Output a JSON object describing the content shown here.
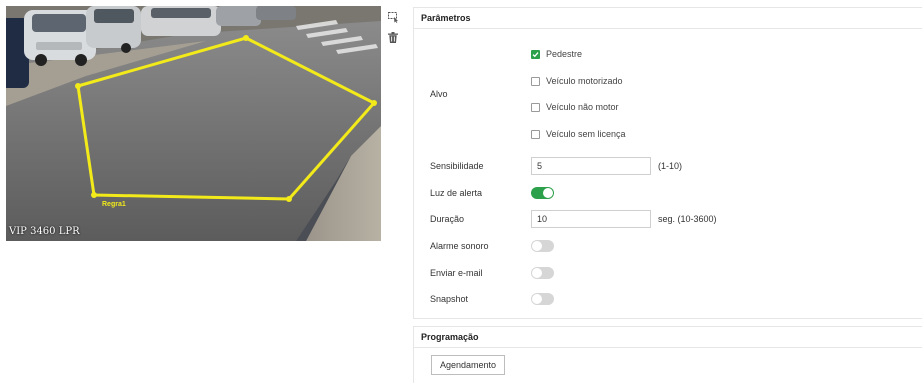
{
  "preview": {
    "osd_text": "VIP 3460 LPR",
    "rule_label": "Regra1",
    "rule_color": "#f3ea1a",
    "tools": [
      {
        "name": "draw-region-icon",
        "tooltip": ""
      },
      {
        "name": "trash-icon",
        "tooltip": ""
      }
    ]
  },
  "parameters": {
    "title": "Parâmetros",
    "alvo_label": "Alvo",
    "targets": [
      {
        "label": "Pedestre",
        "checked": true
      },
      {
        "label": "Veículo motorizado",
        "checked": false
      },
      {
        "label": "Veículo não motor",
        "checked": false
      },
      {
        "label": "Veículo sem licença",
        "checked": false
      }
    ],
    "sensitivity": {
      "label": "Sensibilidade",
      "value": "5",
      "hint": "(1-10)"
    },
    "alert_light": {
      "label": "Luz de alerta",
      "on": true
    },
    "duration": {
      "label": "Duração",
      "value": "10",
      "hint": "seg. (10-3600)"
    },
    "sound_alarm": {
      "label": "Alarme sonoro",
      "on": false
    },
    "send_email": {
      "label": "Enviar e-mail",
      "on": false
    },
    "snapshot": {
      "label": "Snapshot",
      "on": false
    }
  },
  "schedule": {
    "title": "Programação",
    "button_label": "Agendamento"
  },
  "colors": {
    "accent": "#2ca04a",
    "toggle_off": "#d6d6d6",
    "border": "#e6e6e6"
  }
}
